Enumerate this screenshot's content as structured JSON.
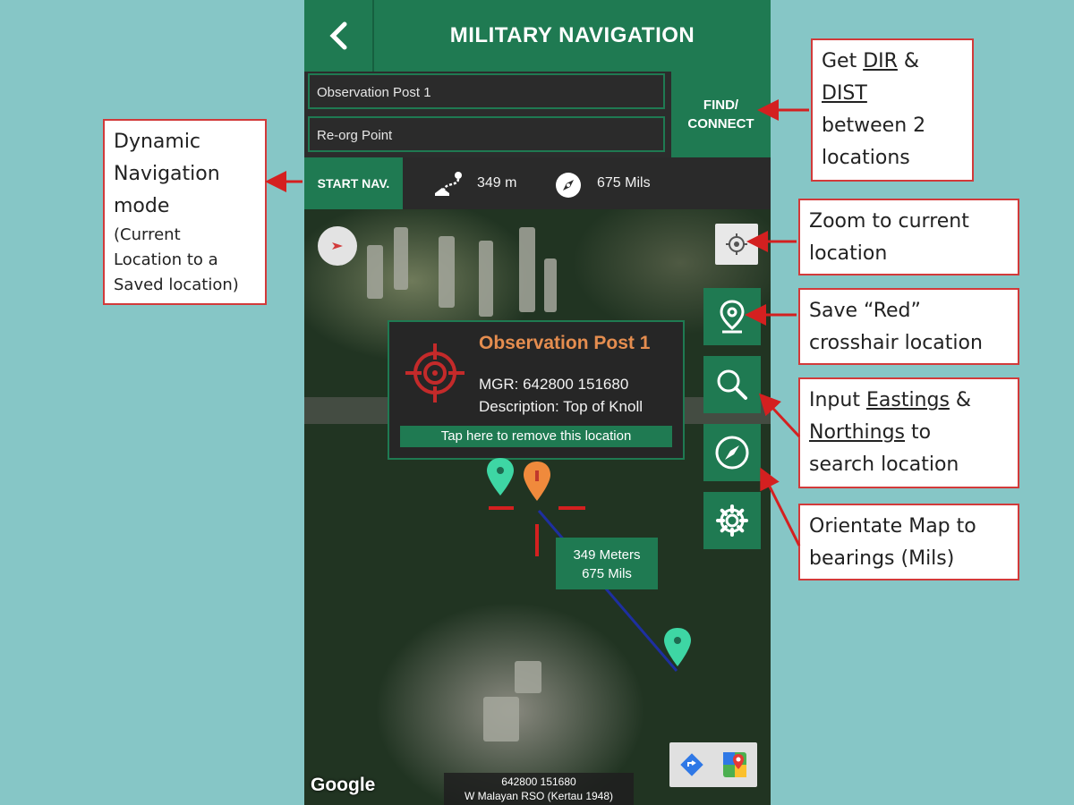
{
  "header": {
    "back_icon": "chevron-left-icon",
    "title": "MILITARY NAVIGATION"
  },
  "inputs": {
    "from_value": "Observation Post 1",
    "to_value": "Re-org Point"
  },
  "find_button": {
    "line1": "FIND/",
    "line2": "CONNECT"
  },
  "nav_bar": {
    "start_label": "START NAV.",
    "distance": "349 m",
    "bearing": "675 Mils"
  },
  "popup": {
    "title": "Observation Post 1",
    "mgr": "MGR: 642800 151680",
    "description": "Description: Top of Knoll",
    "remove": "Tap here to remove this location"
  },
  "distance_label": {
    "line1": "349 Meters",
    "line2": "675 Mils"
  },
  "footer": {
    "google": "Google",
    "coords": "642800 151680",
    "datum": "W Malayan RSO (Kertau 1948)"
  },
  "callouts": {
    "find": {
      "w1": "Get ",
      "u1": "DIR",
      "w2": " & ",
      "u2": "DIST",
      "rest1": "between 2",
      "rest2": "locations"
    },
    "dynamic": {
      "l1": "Dynamic",
      "l2": "Navigation",
      "l3": "mode",
      "s1": "(Current",
      "s2": "Location to a",
      "s3": "Saved location)"
    },
    "zoom": {
      "l1": "Zoom to current",
      "l2": "location"
    },
    "save": {
      "l1": "Save “Red”",
      "l2": "crosshair location"
    },
    "input": {
      "l1a": "Input ",
      "u1": "Eastings",
      "l1b": " &",
      "u2": "Northings",
      "l2b": " to",
      "l3": "search location"
    },
    "orient": {
      "l1": "Orientate Map to",
      "l2": "bearings (Mils)"
    }
  },
  "colors": {
    "primary": "#1f7a52",
    "accent": "#e58d4f",
    "callout_border": "#d23a3a",
    "background": "#86c6c6",
    "marker": "#3ed6a4"
  }
}
